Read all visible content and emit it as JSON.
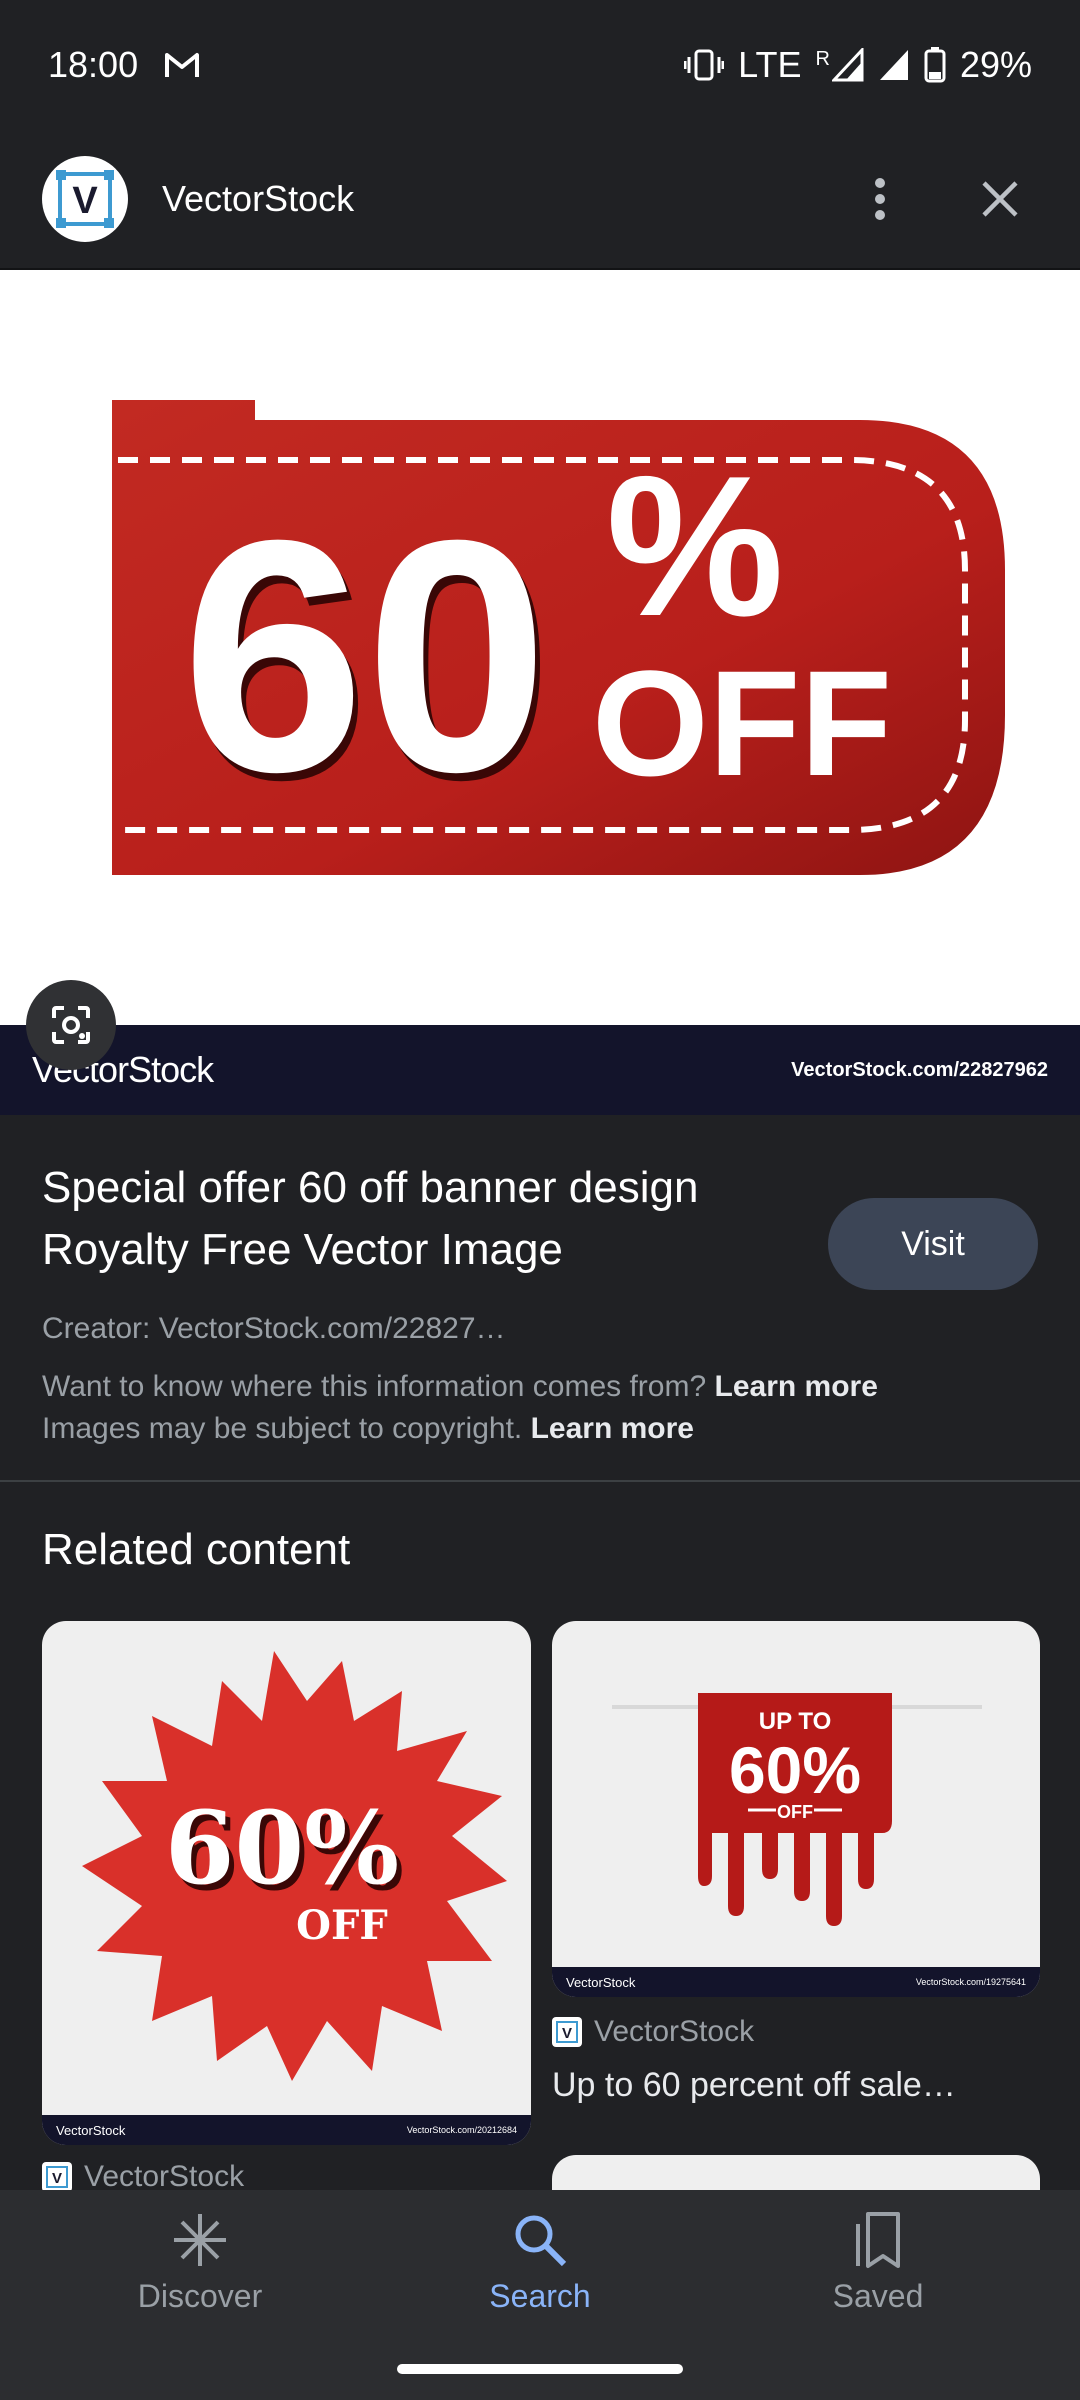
{
  "status_bar": {
    "time": "18:00",
    "network": "LTE",
    "roaming": "R",
    "battery": "29%"
  },
  "app_bar": {
    "site_name": "VectorStock",
    "logo_letter": "V"
  },
  "hero": {
    "banner_number": "60",
    "banner_percent": "%",
    "banner_off": "OFF",
    "strip_brand": "VectorStock",
    "strip_url": "VectorStock.com/22827962",
    "colors": {
      "banner_red": "#c4211e",
      "strip": "#13142b"
    }
  },
  "info": {
    "title": "Special offer 60 off banner design Royalty Free Vector Image",
    "visit_label": "Visit",
    "creator": "Creator: VectorStock.com/22827…",
    "source_note": "Want to know where this information comes from?",
    "copyright_note": "Images may be subject to copyright.",
    "learn_more": "Learn more"
  },
  "related": {
    "heading": "Related content",
    "cards": [
      {
        "big": "60%",
        "small": "OFF",
        "strip_brand": "VectorStock",
        "strip_url": "VectorStock.com/20212684",
        "source": "VectorStock",
        "caption": ""
      },
      {
        "top": "UP TO",
        "big": "60%",
        "small": "OFF",
        "strip_brand": "VectorStock",
        "strip_url": "VectorStock.com/19275641",
        "source": "VectorStock",
        "caption": "Up to 60 percent off sale…"
      }
    ]
  },
  "bottom_nav": {
    "items": [
      {
        "label": "Discover",
        "icon": "asterisk-icon"
      },
      {
        "label": "Search",
        "icon": "search-icon"
      },
      {
        "label": "Saved",
        "icon": "bookmarks-icon"
      }
    ],
    "active": "Search"
  }
}
